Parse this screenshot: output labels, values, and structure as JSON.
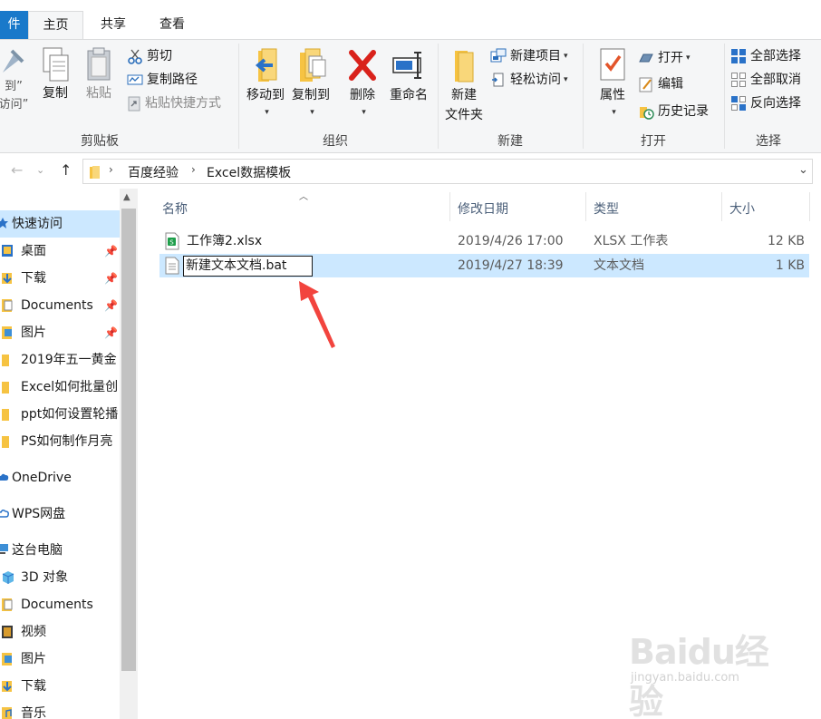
{
  "ribbon_tabs": {
    "file": "件",
    "home": "主页",
    "share": "共享",
    "view": "查看"
  },
  "ribbon": {
    "clipboard": {
      "pin_quick_access": [
        "到”",
        "访问”"
      ],
      "copy": "复制",
      "paste": "粘贴",
      "cut": "剪切",
      "copy_path": "复制路径",
      "paste_shortcut": "粘贴快捷方式",
      "label": "剪贴板"
    },
    "organize": {
      "move_to": "移动到",
      "copy_to": "复制到",
      "delete": "删除",
      "rename": "重命名",
      "label": "组织"
    },
    "new": {
      "new_folder": [
        "新建",
        "文件夹"
      ],
      "new_item": "新建项目",
      "easy_access": "轻松访问",
      "label": "新建"
    },
    "open": {
      "properties": "属性",
      "open": "打开",
      "edit": "编辑",
      "history": "历史记录",
      "label": "打开"
    },
    "select": {
      "select_all": "全部选择",
      "select_none": "全部取消",
      "invert": "反向选择",
      "label": "选择"
    }
  },
  "address": {
    "crumbs": [
      "百度经验",
      "Excel数据模板"
    ]
  },
  "nav": {
    "quick_access": "快速访问",
    "items": [
      {
        "label": "桌面",
        "pinned": true
      },
      {
        "label": "下载",
        "pinned": true
      },
      {
        "label": "Documents",
        "pinned": true
      },
      {
        "label": "图片",
        "pinned": true
      },
      {
        "label": "2019年五一黄金"
      },
      {
        "label": "Excel如何批量创"
      },
      {
        "label": "ppt如何设置轮播"
      },
      {
        "label": "PS如何制作月亮"
      }
    ],
    "onedrive": "OneDrive",
    "wps": "WPS网盘",
    "this_pc": "这台电脑",
    "pc_items": [
      "3D 对象",
      "Documents",
      "视频",
      "图片",
      "下载",
      "音乐"
    ]
  },
  "columns": {
    "name": "名称",
    "date": "修改日期",
    "type": "类型",
    "size": "大小"
  },
  "files": [
    {
      "name": "工作簿2.xlsx",
      "date": "2019/4/26 17:00",
      "type": "XLSX 工作表",
      "size": "12 KB",
      "selected": false,
      "renaming": false
    },
    {
      "name": "新建文本文档.bat",
      "date": "2019/4/27 18:39",
      "type": "文本文档",
      "size": "1 KB",
      "selected": true,
      "renaming": true
    }
  ],
  "watermark": {
    "brand": "Baidu经验",
    "url": "jingyan.baidu.com"
  },
  "colors": {
    "accent": "#1979ca",
    "selection": "#cce8ff",
    "annotation_arrow": "#f2443e"
  },
  "icons": [
    "pin-icon",
    "copy-icon",
    "paste-icon",
    "cut-icon",
    "copy-path-icon",
    "paste-shortcut-icon",
    "move-to-icon",
    "copy-to-icon",
    "delete-icon",
    "rename-icon",
    "new-folder-icon",
    "new-item-icon",
    "easy-access-icon",
    "properties-icon",
    "open-icon",
    "edit-icon",
    "history-icon",
    "select-all-icon",
    "select-none-icon",
    "invert-selection-icon",
    "folder-icon",
    "excel-file-icon",
    "text-file-icon",
    "onedrive-icon",
    "wps-cloud-icon",
    "computer-icon",
    "3d-objects-icon",
    "video-icon",
    "music-icon",
    "download-icon",
    "desktop-icon",
    "pictures-icon",
    "documents-icon",
    "star-icon"
  ]
}
